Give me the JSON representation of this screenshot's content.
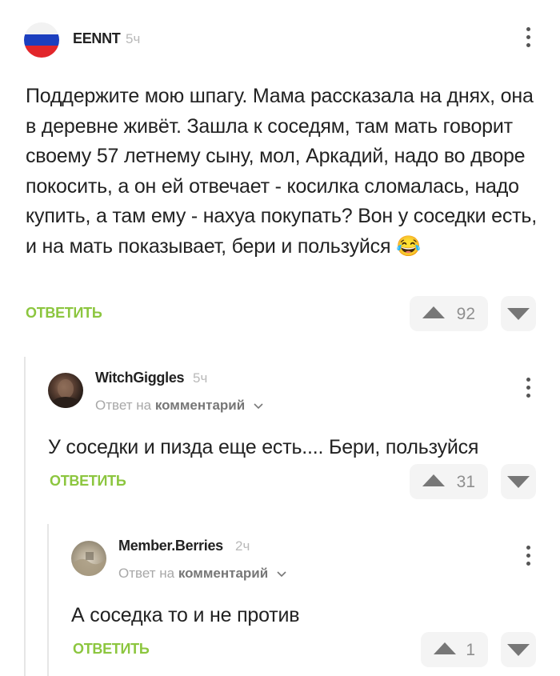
{
  "comments": [
    {
      "author": "EENNT",
      "time": "5ч",
      "avatar": "russian-flag",
      "text": "Поддержите мою шпагу. Мама рассказала на днях, она в деревне живёт. Зашла к соседям, там мать говорит своему 57 летнему сыну, мол, Аркадий, надо во дворе покосить, а он ей отвечает - косилка сломалась, надо купить, а там ему - нахуа покупать? Вон у соседки есть, и на мать показывает, бери и пользуйся",
      "emoji": "😂",
      "reply_label": "ОТВЕТИТЬ",
      "votes": "92"
    },
    {
      "author": "WitchGiggles",
      "time": "5ч",
      "reply_to_prefix": "Ответ на",
      "reply_to_link": "комментарий",
      "text": "У соседки и пизда еще есть.... Бери, пользуйся",
      "reply_label": "ОТВЕТИТЬ",
      "votes": "31"
    },
    {
      "author": "Member.Berries",
      "time": "2ч",
      "reply_to_prefix": "Ответ на",
      "reply_to_link": "комментарий",
      "text": "А соседка то и не против",
      "reply_label": "ОТВЕТИТЬ",
      "votes": "1"
    }
  ],
  "icons": {
    "menu": "kebab-menu-icon",
    "upvote": "upvote-arrow-icon",
    "downvote": "downvote-arrow-icon",
    "chevron": "chevron-down-icon"
  },
  "colors": {
    "reply_green": "#8cc63f",
    "vote_bg": "#f4f4f4",
    "muted": "#a8a8a8"
  }
}
